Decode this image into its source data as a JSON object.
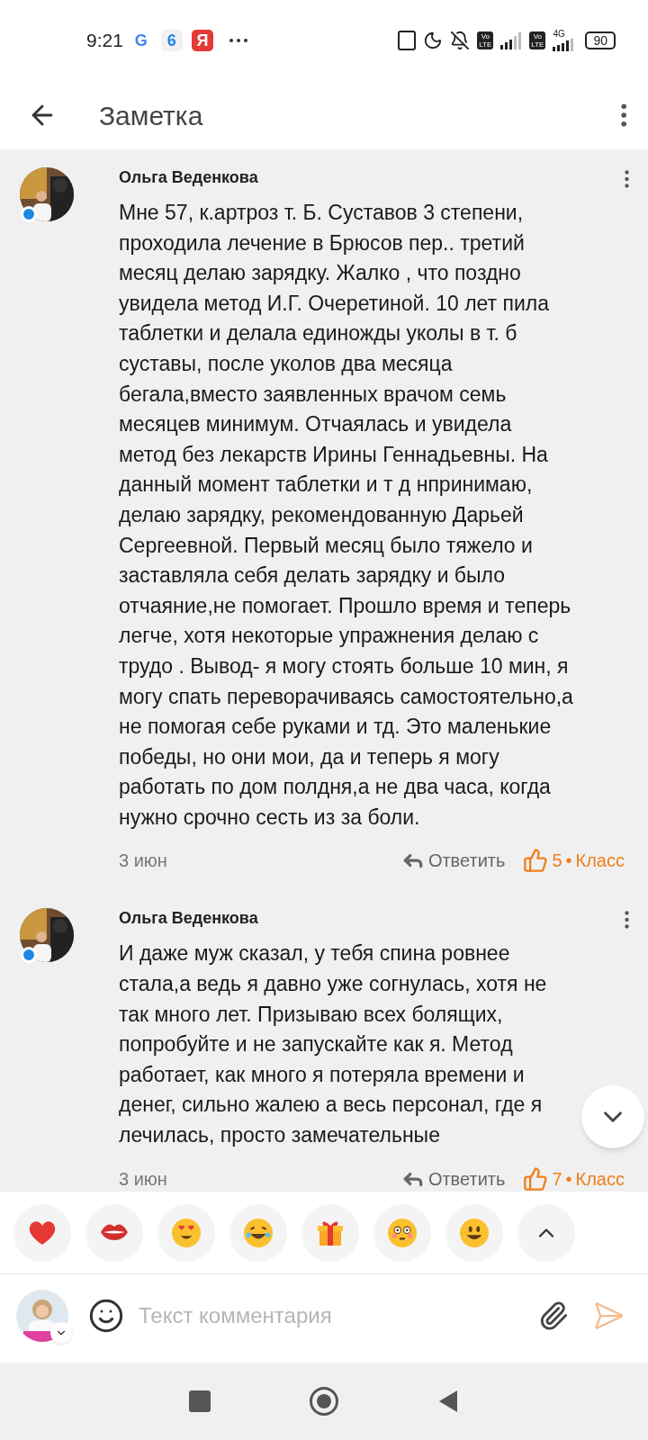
{
  "status_bar": {
    "time": "9:21",
    "notification_icons": [
      {
        "kind": "google",
        "text": "G"
      },
      {
        "kind": "calendar",
        "text": "6"
      },
      {
        "kind": "yandex",
        "text": "Я"
      }
    ],
    "volte": [
      {
        "top": "Vo",
        "bottom": "LTE"
      },
      {
        "top": "Vo",
        "bottom": "LTE"
      }
    ],
    "network": "4G",
    "battery": "90"
  },
  "header": {
    "title": "Заметка"
  },
  "comments": [
    {
      "author": "Ольга Веденкова",
      "online": true,
      "text": "Мне 57, к.артроз т. Б. Суставов 3 степени, проходила лечение в Брюсов пер.. третий месяц делаю зарядку. Жалко , что поздно увидела метод И.Г. Очеретиной. 10 лет пила таблетки и делала единожды уколы в т. б суставы, после уколов два месяца бегала,вместо заявленных врачом семь месяцев минимум. Отчаялась и увидела метод без лекарств Ирины Геннадьевны. На данный момент таблетки и т д нпринимаю, делаю зарядку, рекомендованную Дарьей Сергеевной. Первый месяц было тяжело и заставляла себя делать зарядку и было отчаяние,не помогает. Прошло время и теперь легче, хотя некоторые упражнения делаю с трудо . Вывод- я могу стоять больше 10 мин, я могу спать переворачиваясь самостоятельно,а не помогая себе руками и тд. Это маленькие победы, но они мои, да и теперь я могу работать по дом полдня,а не два часа, когда нужно срочно сесть из за боли.",
      "date": "3 июн",
      "reply": "Ответить",
      "likes": "5",
      "separator": "•",
      "like_label": "Класс"
    },
    {
      "author": "Ольга Веденкова",
      "online": true,
      "text": "И даже муж сказал, у тебя спина ровнее стала,а ведь я давно уже согнулась, хотя не так много лет. Призываю всех болящих, попробуйте и не запускайте как я. Метод работает, как много я потеряла времени и денег, сильно жалею а весь персонал, где я лечилась, просто замечательные",
      "date": "3 июн",
      "reply": "Ответить",
      "likes": "7",
      "separator": "•",
      "like_label": "Класс"
    }
  ],
  "reactions": [
    {
      "kind": "heart"
    },
    {
      "kind": "lips"
    },
    {
      "kind": "heart_eyes"
    },
    {
      "kind": "laughing"
    },
    {
      "kind": "gift"
    },
    {
      "kind": "flushed"
    },
    {
      "kind": "smiley"
    },
    {
      "kind": "expand"
    }
  ],
  "comment_input": {
    "placeholder": "Текст комментария"
  }
}
